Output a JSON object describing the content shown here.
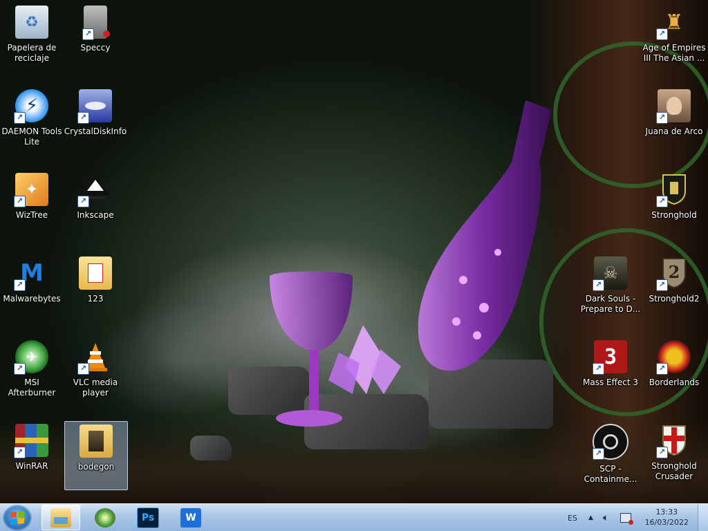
{
  "desktop": {
    "icons": [
      {
        "id": "recycle",
        "label": "Papelera de reciclaje",
        "icon": "recycle-bin-icon",
        "shortcut": false
      },
      {
        "id": "daemon",
        "label": "DAEMON Tools Lite",
        "icon": "lightning-disc-icon",
        "shortcut": true
      },
      {
        "id": "wiztree",
        "label": "WizTree",
        "icon": "wand-icon",
        "shortcut": true
      },
      {
        "id": "malwarebytes",
        "label": "Malwarebytes",
        "icon": "malwarebytes-m-icon",
        "shortcut": true
      },
      {
        "id": "afterburner",
        "label": "MSI Afterburner",
        "icon": "afterburner-icon",
        "shortcut": true
      },
      {
        "id": "winrar",
        "label": "WinRAR",
        "icon": "winrar-books-icon",
        "shortcut": true
      },
      {
        "id": "speccy",
        "label": "Speccy",
        "icon": "computer-tower-icon",
        "shortcut": true
      },
      {
        "id": "crystaldisk",
        "label": "CrystalDiskInfo",
        "icon": "hard-disk-icon",
        "shortcut": true
      },
      {
        "id": "inkscape",
        "label": "Inkscape",
        "icon": "inkscape-icon",
        "shortcut": true
      },
      {
        "id": "folder123",
        "label": "123",
        "icon": "folder-pdf-icon",
        "shortcut": false
      },
      {
        "id": "vlc",
        "label": "VLC media player",
        "icon": "traffic-cone-icon",
        "shortcut": true
      },
      {
        "id": "bodegon",
        "label": "bodegon",
        "icon": "folder-icon",
        "shortcut": false,
        "selected": true
      },
      {
        "id": "aoe3",
        "label": "Age of Empires III The Asian ...",
        "icon": "samurai-helmet-icon",
        "shortcut": true
      },
      {
        "id": "juana",
        "label": "Juana de Arco",
        "icon": "knight-portrait-icon",
        "shortcut": true
      },
      {
        "id": "stronghold",
        "label": "Stronghold",
        "icon": "castle-shield-icon",
        "shortcut": true
      },
      {
        "id": "stronghold2",
        "label": "Stronghold2",
        "icon": "shield-2-icon",
        "shortcut": true
      },
      {
        "id": "darksouls",
        "label": "Dark Souls - Prepare to D...",
        "icon": "dark-souls-icon",
        "shortcut": true
      },
      {
        "id": "masseffect3",
        "label": "Mass Effect 3",
        "icon": "mass-effect-3-icon",
        "shortcut": true
      },
      {
        "id": "borderlands",
        "label": "Borderlands",
        "icon": "borderlands-badge-icon",
        "shortcut": true
      },
      {
        "id": "scp",
        "label": "SCP - Containme...",
        "icon": "scp-logo-icon",
        "shortcut": true
      },
      {
        "id": "crusader",
        "label": "Stronghold Crusader",
        "icon": "crusader-shield-icon",
        "shortcut": true
      }
    ]
  },
  "taskbar": {
    "start": {
      "icon": "windows-logo-icon"
    },
    "pinned": [
      {
        "id": "explorer",
        "icon": "file-explorer-icon",
        "active": true
      },
      {
        "id": "tool",
        "icon": "green-tool-icon",
        "active": false
      },
      {
        "id": "photoshop",
        "icon": "photoshop-icon",
        "glyph": "Ps",
        "active": false
      },
      {
        "id": "wps",
        "icon": "wps-office-icon",
        "glyph": "W",
        "active": false
      }
    ],
    "tray": {
      "language": "ES",
      "time": "13:33",
      "date": "16/03/2022",
      "icons": [
        "show-hidden-icons-chevron-icon",
        "volume-icon",
        "network-icon"
      ]
    }
  },
  "colors": {
    "taskbar": "#a9c6e6",
    "selection": "#aac8e6",
    "ps": "#001e36",
    "wps": "#1e6fd9"
  }
}
